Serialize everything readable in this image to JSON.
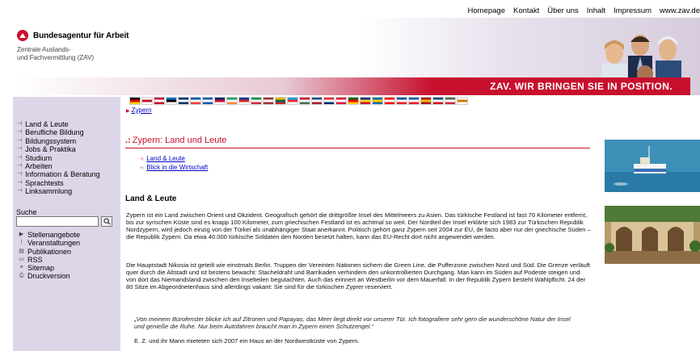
{
  "topnav": {
    "items": [
      "Homepage",
      "Kontakt",
      "Über uns",
      "Inhalt",
      "Impressum",
      "www.zav.de"
    ]
  },
  "header": {
    "logo_title": "Bundesagentur für Arbeit",
    "logo_subtitle": "Zentrale Auslands-\nund Fachvermittlung (ZAV)",
    "banner_text": "ZAV. WIR BRINGEN SIE IN POSITION."
  },
  "breadcrumb": {
    "label": "Zypern"
  },
  "sidebar": {
    "nav": [
      "Land & Leute",
      "Berufliche Bildung",
      "Bildungssystem",
      "Jobs & Praktika",
      "Studium",
      "Arbeiten",
      "Information & Beratung",
      "Sprachtests",
      "Linksammlung"
    ],
    "search_label": "Suche",
    "links": [
      "Stellenangebote",
      "Veranstaltungen",
      "Publikationen",
      "RSS",
      "Sitemap",
      "Druckversion"
    ]
  },
  "main": {
    "page_title": "Zypern: Land und Leute",
    "toc": [
      "Land & Leute",
      "Blick in die Wirtschaft"
    ],
    "section_heading": "Land & Leute",
    "paragraph1": "Zypern ist ein Land zwischen Orient und Okzident. Geografisch gehört die drittgrößte Insel des Mittelmeers zu Asien. Das türkische Festland ist fast 70 Kilometer entfernt, bis zur syrischen Küste sind es knapp 100 Kilometer, zum griechischen Festland ist es achtmal so weit. Der Nordteil der Insel erklärte sich 1983 zur Türkischen Republik Nordzypern, wird jedoch einzig von der Türkei als unabhängiger Staat anerkannt. Politisch gehört ganz Zypern seit 2004 zur EU, de facto aber nur der griechische Süden – die Republik Zypern. Da etwa 40.000 türkische Soldaten den Norden besetzt halten, kann das EU-Recht dort nicht angewendet werden.",
    "paragraph2": "Die Hauptstadt Nikosia ist geteilt wie einstmals Berlin. Truppen der Vereinten Nationen sichern die Green Line, die Pufferzone zwischen Nord und Süd. Die Grenze verläuft quer durch die Altstadt und ist bestens bewacht: Stacheldraht und Barrikaden verhindern den unkontrollierten Durchgang. Man kann im Süden auf Podeste steigen und von dort das Niemandsland zwischen den Inselteilen begutachten. Auch das erinnert an Westberlin vor dem Mauerfall. In der Republik Zypern besteht Wahlpflicht. 24 der 80 Sitze im Abgeordnetenhaus sind allerdings vakant: Sie sind für die türkischen Zyprer reserviert.",
    "quote": "„Von meinem Bürofenster blicke ich auf Zitronen und Papayas, das Meer liegt direkt vor unserer Tür. Ich fotografiere sehr gern die wunderschöne Natur der Insel und genieße die Ruhe. Nur beim Autofahren braucht man in Zypern einen Schutzengel.“",
    "paragraph3": "E. Z. und ihr Mann mieteten sich 2007 ein Haus an der Nordwestküste von Zypern."
  },
  "flags": [
    [
      "#000",
      "#dd0000",
      "#ffce00"
    ],
    [
      "#fff",
      "#c8102e",
      "#fff"
    ],
    [
      "#c60c30",
      "#fff",
      "#c60c30"
    ],
    [
      "#0072ce",
      "#000",
      "#fff"
    ],
    [
      "#002f6c",
      "#fff",
      "#002f6c"
    ],
    [
      "#0055a4",
      "#fff",
      "#ef4135"
    ],
    [
      "#0d5eaf",
      "#fff",
      "#0d5eaf"
    ],
    [
      "#012169",
      "#c8102e",
      "#fff"
    ],
    [
      "#169b62",
      "#fff",
      "#ff883e"
    ],
    [
      "#003897",
      "#d72828",
      "#fff"
    ],
    [
      "#009246",
      "#fff",
      "#ce2b37"
    ],
    [
      "#9e3039",
      "#fff",
      "#9e3039"
    ],
    [
      "#fdb913",
      "#006a44",
      "#c1272d"
    ],
    [
      "#00a1de",
      "#ed2939",
      "#fff"
    ],
    [
      "#ce1126",
      "#fff",
      "#477050"
    ],
    [
      "#21468b",
      "#fff",
      "#ae1c28"
    ],
    [
      "#ef2b2d",
      "#fff",
      "#002868"
    ],
    [
      "#dc143c",
      "#fff",
      "#dc143c"
    ],
    [
      "#006600",
      "#ff0000",
      "#ffcc00"
    ],
    [
      "#002b7f",
      "#fcd116",
      "#ce1126"
    ],
    [
      "#006aa7",
      "#fecc00",
      "#006aa7"
    ],
    [
      "#ff0000",
      "#fff",
      "#ff0000"
    ],
    [
      "#0b4ea2",
      "#fff",
      "#ee1c25"
    ],
    [
      "#005da4",
      "#fff",
      "#ed1c24"
    ],
    [
      "#aa151b",
      "#f1bf00",
      "#aa151b"
    ],
    [
      "#11457e",
      "#fff",
      "#d7141a"
    ],
    [
      "#436f4d",
      "#fff",
      "#cd2a3e"
    ],
    [
      "#fff",
      "#d57800",
      "#fff"
    ]
  ]
}
